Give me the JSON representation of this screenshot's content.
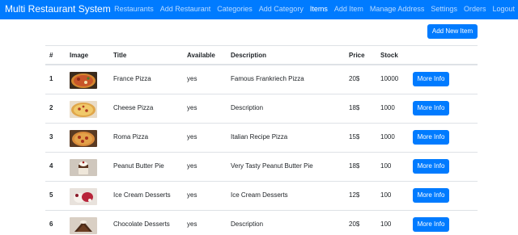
{
  "navbar": {
    "brand": "Multi Restaurant System",
    "links": [
      "Restaurants",
      "Add Restaurant",
      "Categories",
      "Add Category",
      "Items",
      "Add Item",
      "Manage Address",
      "Settings",
      "Orders",
      "Logout"
    ],
    "active": "Items"
  },
  "actions": {
    "add_new_item": "Add New Item"
  },
  "table": {
    "headers": {
      "num": "#",
      "image": "Image",
      "title": "Title",
      "available": "Available",
      "description": "Description",
      "price": "Price",
      "stock": "Stock"
    },
    "more_info_label": "More Info",
    "rows": [
      {
        "num": "1",
        "title": "France Pizza",
        "available": "yes",
        "description": "Famous Frankriech Pizza",
        "price": "20$",
        "stock": "10000",
        "image_icon": "pizza-image"
      },
      {
        "num": "2",
        "title": "Cheese Pizza",
        "available": "yes",
        "description": "Description",
        "price": "18$",
        "stock": "1000",
        "image_icon": "pizza-image"
      },
      {
        "num": "3",
        "title": "Roma Pizza",
        "available": "yes",
        "description": "Italian Recipe Pizza",
        "price": "15$",
        "stock": "1000",
        "image_icon": "pizza-image"
      },
      {
        "num": "4",
        "title": "Peanut Butter Pie",
        "available": "yes",
        "description": "Very Tasty Peanut Butter Pie",
        "price": "18$",
        "stock": "100",
        "image_icon": "dessert-image"
      },
      {
        "num": "5",
        "title": "Ice Cream Desserts",
        "available": "yes",
        "description": "Ice Cream Desserts",
        "price": "12$",
        "stock": "100",
        "image_icon": "dessert-image"
      },
      {
        "num": "6",
        "title": "Chocolate Desserts",
        "available": "yes",
        "description": "Description",
        "price": "20$",
        "stock": "100",
        "image_icon": "dessert-image"
      }
    ]
  },
  "colors": {
    "primary": "#007bff",
    "border": "#dee2e6",
    "text": "#212529"
  }
}
